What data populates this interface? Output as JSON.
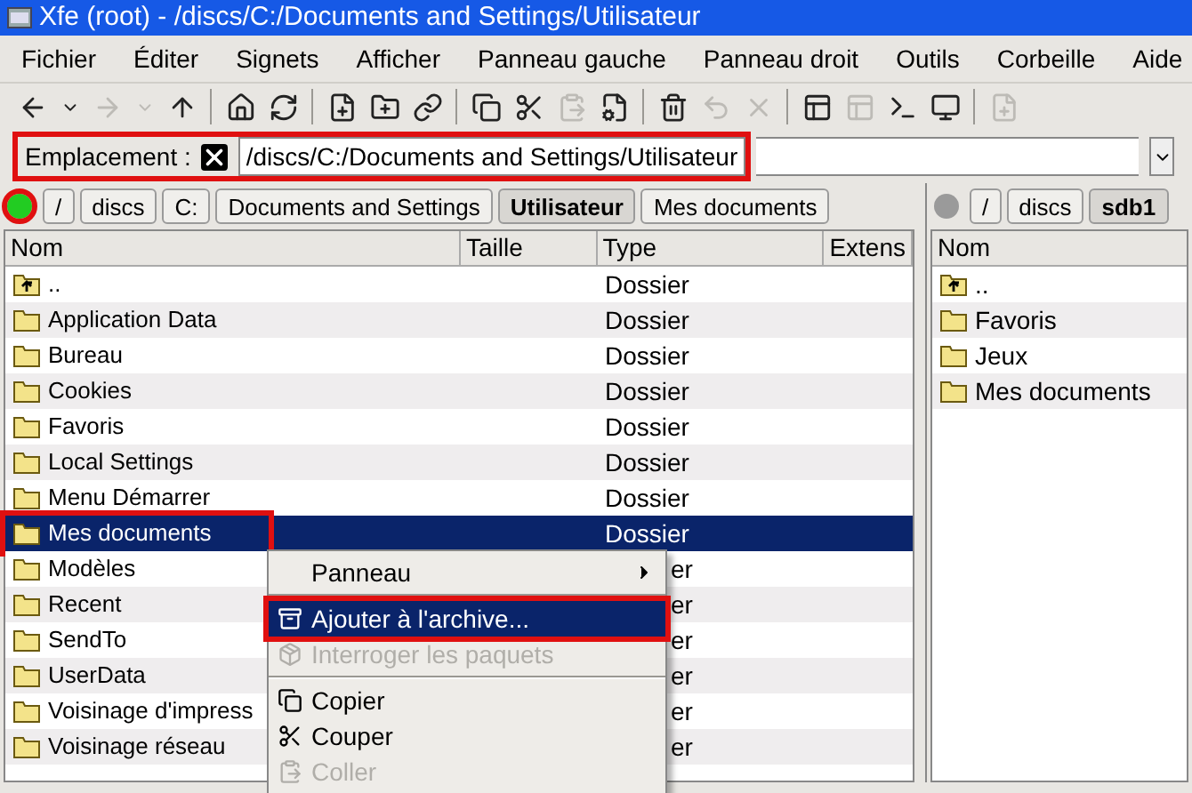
{
  "window": {
    "title": "Xfe (root) - /discs/C:/Documents and Settings/Utilisateur"
  },
  "menubar": [
    "Fichier",
    "Éditer",
    "Signets",
    "Afficher",
    "Panneau gauche",
    "Panneau droit",
    "Outils",
    "Corbeille",
    "Aide"
  ],
  "toolbar": [
    {
      "kind": "back",
      "disabled": false
    },
    {
      "kind": "dropdown",
      "disabled": false
    },
    {
      "kind": "forward",
      "disabled": true
    },
    {
      "kind": "dropdown",
      "disabled": true
    },
    {
      "kind": "up",
      "disabled": false
    },
    {
      "kind": "sep"
    },
    {
      "kind": "home",
      "disabled": false
    },
    {
      "kind": "refresh",
      "disabled": false
    },
    {
      "kind": "sep"
    },
    {
      "kind": "newfile",
      "disabled": false
    },
    {
      "kind": "newfolder",
      "disabled": false
    },
    {
      "kind": "link",
      "disabled": false
    },
    {
      "kind": "sep"
    },
    {
      "kind": "copy",
      "disabled": false
    },
    {
      "kind": "cut",
      "disabled": false
    },
    {
      "kind": "paste",
      "disabled": true
    },
    {
      "kind": "properties",
      "disabled": false
    },
    {
      "kind": "sep"
    },
    {
      "kind": "trash",
      "disabled": false
    },
    {
      "kind": "restore",
      "disabled": true
    },
    {
      "kind": "delete",
      "disabled": true
    },
    {
      "kind": "sep"
    },
    {
      "kind": "panel",
      "disabled": false
    },
    {
      "kind": "panel",
      "disabled": true
    },
    {
      "kind": "terminal",
      "disabled": false
    },
    {
      "kind": "monitor",
      "disabled": false
    },
    {
      "kind": "sep"
    },
    {
      "kind": "newfile",
      "disabled": true
    }
  ],
  "location": {
    "label": "Emplacement :",
    "value": "/discs/C:/Documents and Settings/Utilisateur",
    "highlighted": true
  },
  "left_panel": {
    "status": {
      "active": true,
      "highlighted": true
    },
    "breadcrumbs": [
      {
        "label": "/",
        "selected": false
      },
      {
        "label": "discs",
        "selected": false
      },
      {
        "label": "C:",
        "selected": false
      },
      {
        "label": "Documents and Settings",
        "selected": false
      },
      {
        "label": "Utilisateur",
        "selected": true
      },
      {
        "label": "Mes documents",
        "selected": false
      }
    ],
    "columns": [
      "Nom",
      "Taille",
      "Type",
      "Extens"
    ],
    "rows": [
      {
        "name": "..",
        "kind": "parent",
        "type": "Dossier",
        "selected": false,
        "highlighted": false
      },
      {
        "name": "Application Data",
        "kind": "folder",
        "type": "Dossier",
        "selected": false,
        "highlighted": false
      },
      {
        "name": "Bureau",
        "kind": "folder",
        "type": "Dossier",
        "selected": false,
        "highlighted": false
      },
      {
        "name": "Cookies",
        "kind": "folder",
        "type": "Dossier",
        "selected": false,
        "highlighted": false
      },
      {
        "name": "Favoris",
        "kind": "folder",
        "type": "Dossier",
        "selected": false,
        "highlighted": false
      },
      {
        "name": "Local Settings",
        "kind": "folder",
        "type": "Dossier",
        "selected": false,
        "highlighted": false
      },
      {
        "name": "Menu Démarrer",
        "kind": "folder",
        "type": "Dossier",
        "selected": false,
        "highlighted": false
      },
      {
        "name": "Mes documents",
        "kind": "folder",
        "type": "Dossier",
        "selected": true,
        "highlighted": true
      },
      {
        "name": "Modèles",
        "kind": "folder",
        "type": "er",
        "selected": false,
        "highlighted": false
      },
      {
        "name": "Recent",
        "kind": "folder",
        "type": "er",
        "selected": false,
        "highlighted": false
      },
      {
        "name": "SendTo",
        "kind": "folder",
        "type": "er",
        "selected": false,
        "highlighted": false
      },
      {
        "name": "UserData",
        "kind": "folder",
        "type": "er",
        "selected": false,
        "highlighted": false
      },
      {
        "name": "Voisinage d'impress",
        "kind": "folder",
        "type": "er",
        "selected": false,
        "highlighted": false
      },
      {
        "name": "Voisinage réseau",
        "kind": "folder",
        "type": "er",
        "selected": false,
        "highlighted": false
      }
    ]
  },
  "right_panel": {
    "status": {
      "active": false
    },
    "breadcrumbs": [
      {
        "label": "/",
        "selected": false
      },
      {
        "label": "discs",
        "selected": false
      },
      {
        "label": "sdb1",
        "selected": true
      }
    ],
    "columns": [
      "Nom"
    ],
    "rows": [
      {
        "name": "..",
        "kind": "parent"
      },
      {
        "name": "Favoris",
        "kind": "folder"
      },
      {
        "name": "Jeux",
        "kind": "folder"
      },
      {
        "name": "Mes documents",
        "kind": "folder"
      }
    ]
  },
  "context_menu": [
    {
      "kind": "submenu",
      "label": "Panneau",
      "selected": false,
      "disabled": false,
      "highlighted": false
    },
    {
      "kind": "sep"
    },
    {
      "kind": "archive",
      "label": "Ajouter à l'archive...",
      "selected": true,
      "disabled": false,
      "highlighted": true
    },
    {
      "kind": "package",
      "label": "Interroger les paquets",
      "selected": false,
      "disabled": true,
      "highlighted": false
    },
    {
      "kind": "sep"
    },
    {
      "kind": "copy",
      "label": "Copier",
      "selected": false,
      "disabled": false,
      "highlighted": false
    },
    {
      "kind": "cut",
      "label": "Couper",
      "selected": false,
      "disabled": false,
      "highlighted": false
    },
    {
      "kind": "paste",
      "label": "Coller",
      "selected": false,
      "disabled": true,
      "highlighted": false
    }
  ]
}
